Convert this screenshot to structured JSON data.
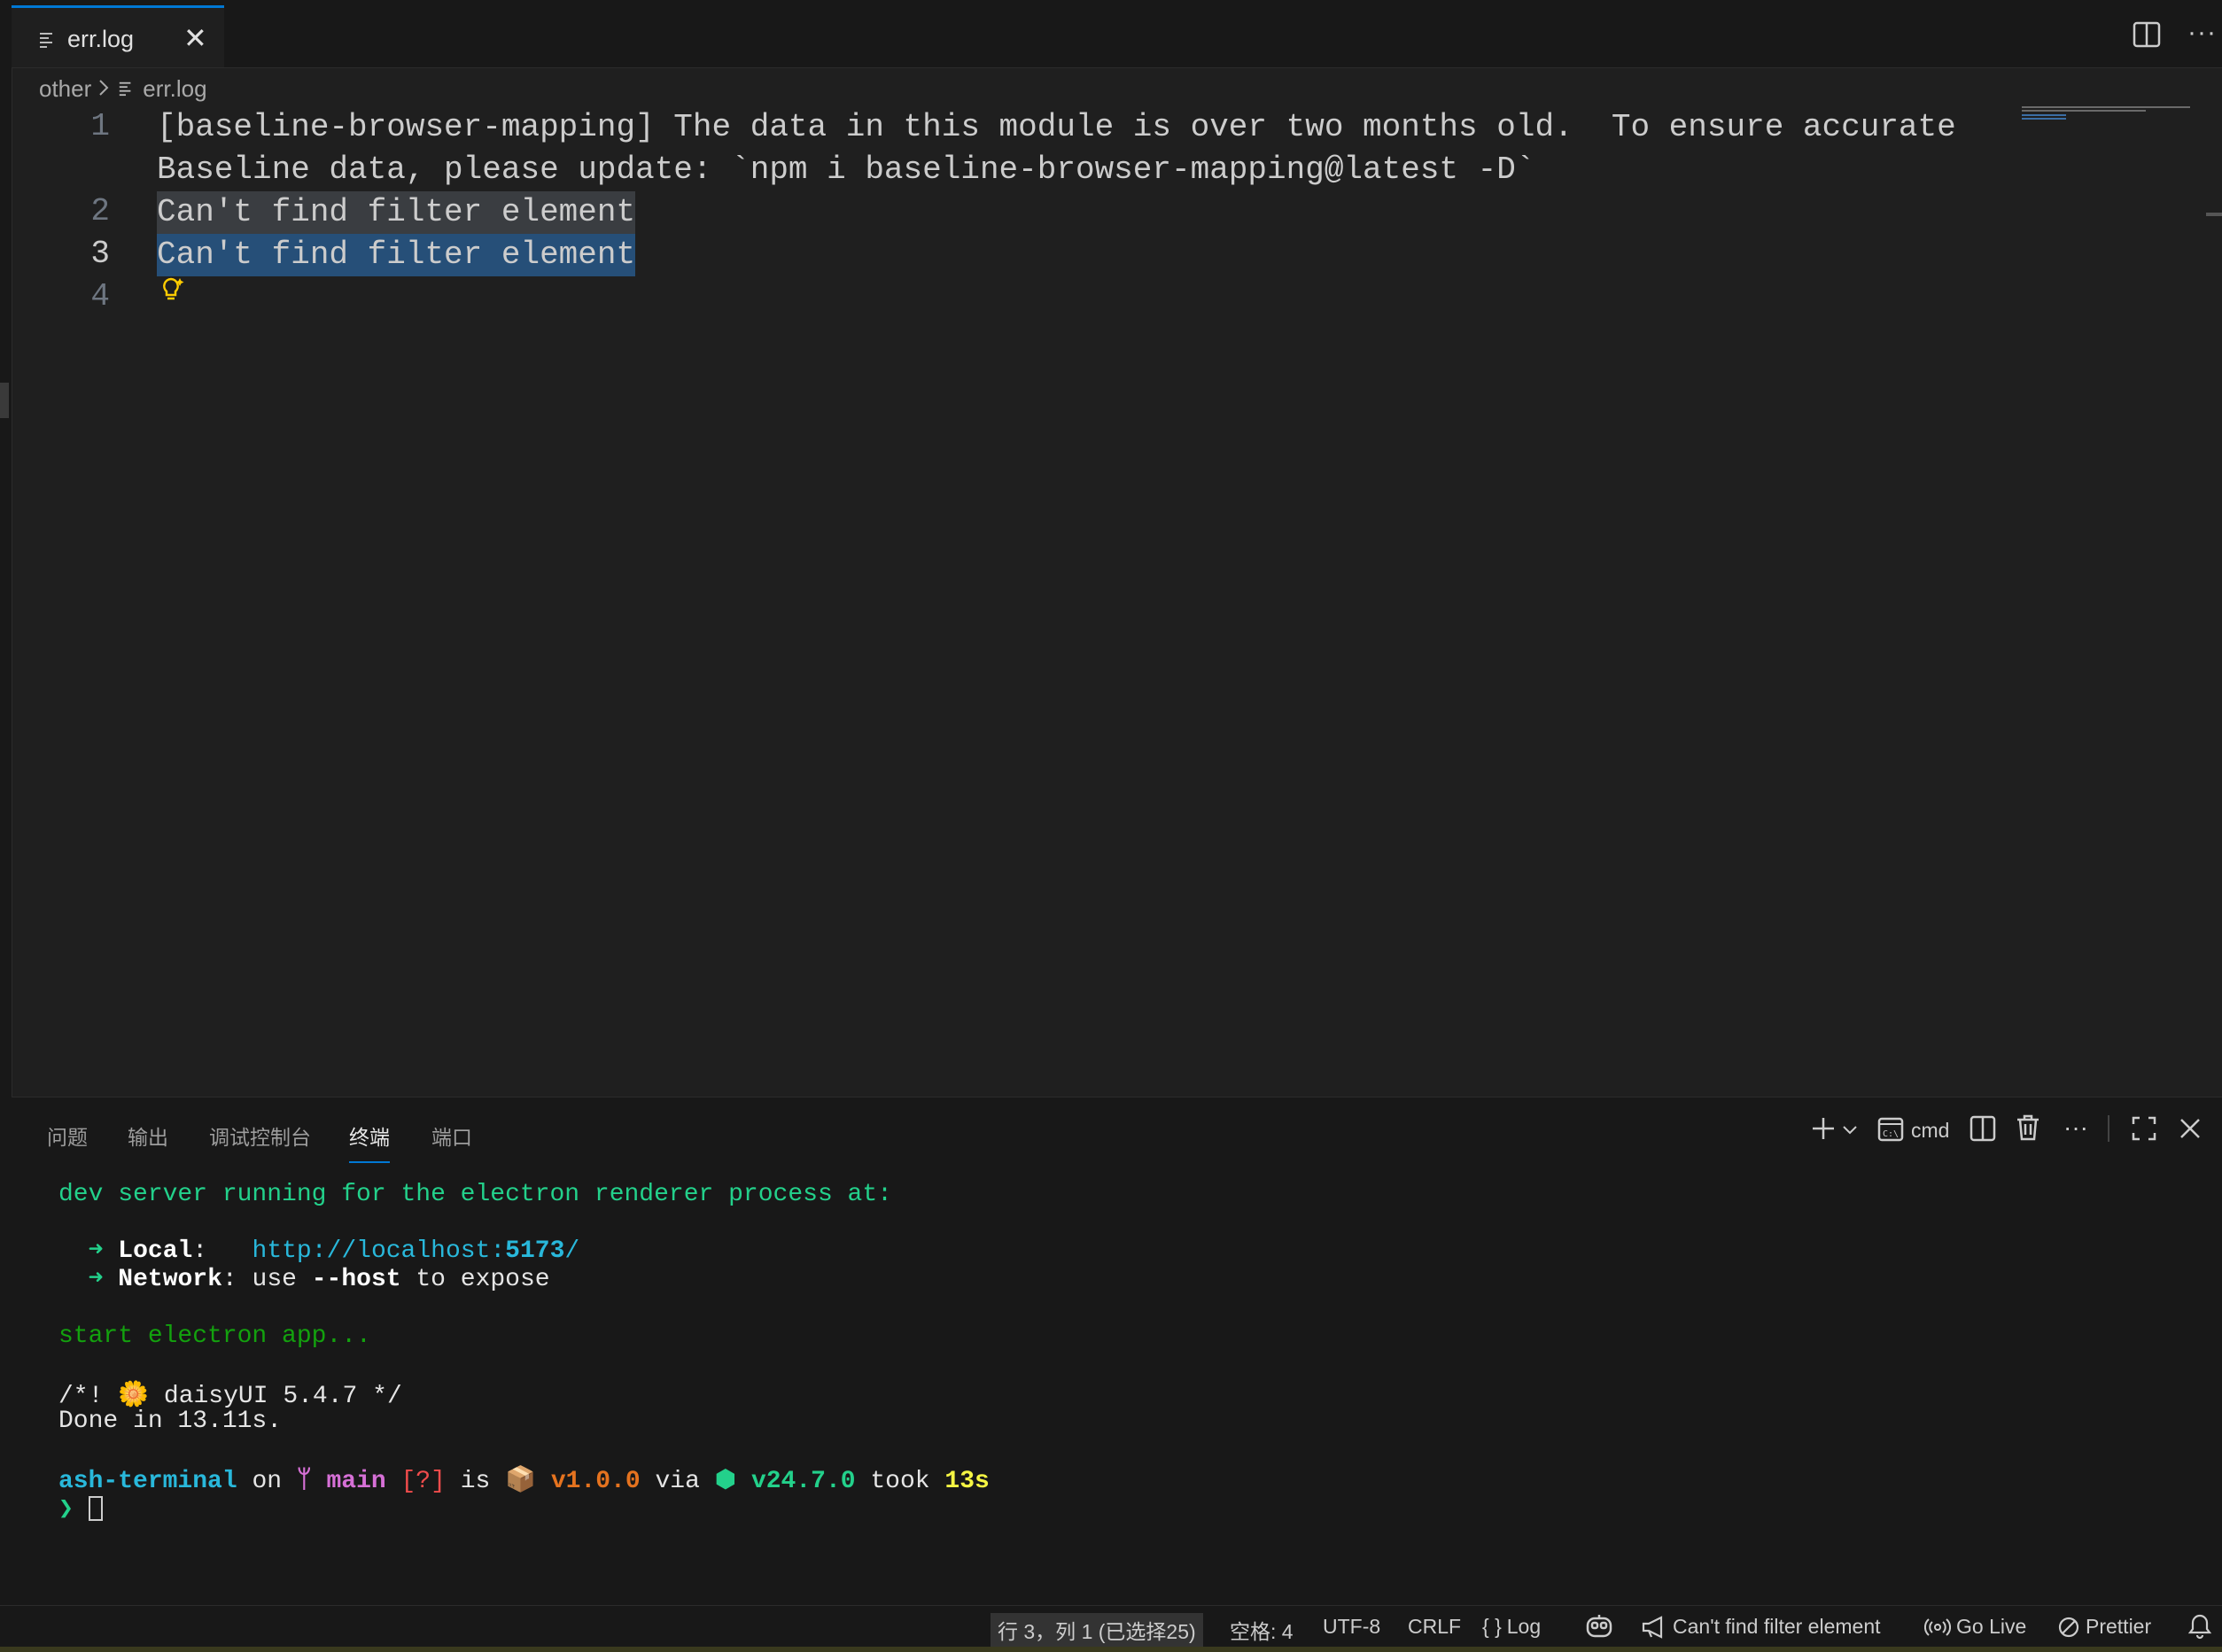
{
  "tab": {
    "file_name": "err.log",
    "close_glyph": "✕",
    "more_glyph": "···"
  },
  "breadcrumb": {
    "folder": "other",
    "file": "err.log"
  },
  "editor": {
    "lines": [
      {
        "number": "1",
        "text": "[baseline-browser-mapping] The data in this module is over two months old.  To ensure accurate",
        "wrap": "Baseline data, please update: `npm i baseline-browser-mapping@latest -D`"
      },
      {
        "number": "2",
        "text": "Can't find filter element"
      },
      {
        "number": "3",
        "text": "Can't find filter element"
      },
      {
        "number": "4",
        "text": ""
      }
    ],
    "lightbulb_icon": "lightbulb-sparkle-icon"
  },
  "panel": {
    "tabs": [
      "问题",
      "输出",
      "调试控制台",
      "终端",
      "端口"
    ],
    "active_tab": "终端",
    "shell_label": "cmd",
    "terminal": {
      "line1": "dev server running for the electron renderer process at:",
      "arrow": "➜",
      "local_label": "Local",
      "local_colon": ":   ",
      "local_url_prefix": "http://localhost:",
      "local_port": "5173",
      "local_url_suffix": "/",
      "network_label": "Network",
      "network_text1": ": use ",
      "network_flag": "--host",
      "network_text2": " to expose",
      "start_line": "start electron app...",
      "daisy_prefix": "/*! ",
      "daisy_icon": "🌼",
      "daisy_text": " daisyUI 5.4.7 */",
      "done_line": "Done in 13.11s.",
      "prompt_dir": "ash-terminal",
      "prompt_on": " on ",
      "branch_icon": "",
      "branch": "main",
      "status": "[?]",
      "prompt_is": " is ",
      "package_icon": "📦",
      "package_version": "v1.0.0",
      "prompt_via": " via ",
      "node_icon": "⬢",
      "node_version": "v24.7.0",
      "prompt_took": " took ",
      "duration": "13s",
      "prompt_char": "❯"
    }
  },
  "statusbar": {
    "position": "行 3，列 1 (已选择25)",
    "spaces": "空格: 4",
    "encoding": "UTF-8",
    "eol": "CRLF",
    "language": "Log",
    "notification": "Can't find filter element",
    "golive": "Go Live",
    "prettier": "Prettier"
  }
}
